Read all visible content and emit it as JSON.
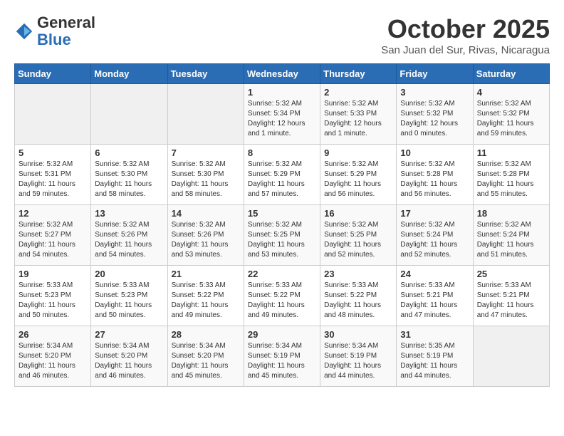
{
  "logo": {
    "general": "General",
    "blue": "Blue"
  },
  "title": "October 2025",
  "location": "San Juan del Sur, Rivas, Nicaragua",
  "days_of_week": [
    "Sunday",
    "Monday",
    "Tuesday",
    "Wednesday",
    "Thursday",
    "Friday",
    "Saturday"
  ],
  "weeks": [
    [
      {
        "day": "",
        "info": ""
      },
      {
        "day": "",
        "info": ""
      },
      {
        "day": "",
        "info": ""
      },
      {
        "day": "1",
        "info": "Sunrise: 5:32 AM\nSunset: 5:34 PM\nDaylight: 12 hours\nand 1 minute."
      },
      {
        "day": "2",
        "info": "Sunrise: 5:32 AM\nSunset: 5:33 PM\nDaylight: 12 hours\nand 1 minute."
      },
      {
        "day": "3",
        "info": "Sunrise: 5:32 AM\nSunset: 5:32 PM\nDaylight: 12 hours\nand 0 minutes."
      },
      {
        "day": "4",
        "info": "Sunrise: 5:32 AM\nSunset: 5:32 PM\nDaylight: 11 hours\nand 59 minutes."
      }
    ],
    [
      {
        "day": "5",
        "info": "Sunrise: 5:32 AM\nSunset: 5:31 PM\nDaylight: 11 hours\nand 59 minutes."
      },
      {
        "day": "6",
        "info": "Sunrise: 5:32 AM\nSunset: 5:30 PM\nDaylight: 11 hours\nand 58 minutes."
      },
      {
        "day": "7",
        "info": "Sunrise: 5:32 AM\nSunset: 5:30 PM\nDaylight: 11 hours\nand 58 minutes."
      },
      {
        "day": "8",
        "info": "Sunrise: 5:32 AM\nSunset: 5:29 PM\nDaylight: 11 hours\nand 57 minutes."
      },
      {
        "day": "9",
        "info": "Sunrise: 5:32 AM\nSunset: 5:29 PM\nDaylight: 11 hours\nand 56 minutes."
      },
      {
        "day": "10",
        "info": "Sunrise: 5:32 AM\nSunset: 5:28 PM\nDaylight: 11 hours\nand 56 minutes."
      },
      {
        "day": "11",
        "info": "Sunrise: 5:32 AM\nSunset: 5:28 PM\nDaylight: 11 hours\nand 55 minutes."
      }
    ],
    [
      {
        "day": "12",
        "info": "Sunrise: 5:32 AM\nSunset: 5:27 PM\nDaylight: 11 hours\nand 54 minutes."
      },
      {
        "day": "13",
        "info": "Sunrise: 5:32 AM\nSunset: 5:26 PM\nDaylight: 11 hours\nand 54 minutes."
      },
      {
        "day": "14",
        "info": "Sunrise: 5:32 AM\nSunset: 5:26 PM\nDaylight: 11 hours\nand 53 minutes."
      },
      {
        "day": "15",
        "info": "Sunrise: 5:32 AM\nSunset: 5:25 PM\nDaylight: 11 hours\nand 53 minutes."
      },
      {
        "day": "16",
        "info": "Sunrise: 5:32 AM\nSunset: 5:25 PM\nDaylight: 11 hours\nand 52 minutes."
      },
      {
        "day": "17",
        "info": "Sunrise: 5:32 AM\nSunset: 5:24 PM\nDaylight: 11 hours\nand 52 minutes."
      },
      {
        "day": "18",
        "info": "Sunrise: 5:32 AM\nSunset: 5:24 PM\nDaylight: 11 hours\nand 51 minutes."
      }
    ],
    [
      {
        "day": "19",
        "info": "Sunrise: 5:33 AM\nSunset: 5:23 PM\nDaylight: 11 hours\nand 50 minutes."
      },
      {
        "day": "20",
        "info": "Sunrise: 5:33 AM\nSunset: 5:23 PM\nDaylight: 11 hours\nand 50 minutes."
      },
      {
        "day": "21",
        "info": "Sunrise: 5:33 AM\nSunset: 5:22 PM\nDaylight: 11 hours\nand 49 minutes."
      },
      {
        "day": "22",
        "info": "Sunrise: 5:33 AM\nSunset: 5:22 PM\nDaylight: 11 hours\nand 49 minutes."
      },
      {
        "day": "23",
        "info": "Sunrise: 5:33 AM\nSunset: 5:22 PM\nDaylight: 11 hours\nand 48 minutes."
      },
      {
        "day": "24",
        "info": "Sunrise: 5:33 AM\nSunset: 5:21 PM\nDaylight: 11 hours\nand 47 minutes."
      },
      {
        "day": "25",
        "info": "Sunrise: 5:33 AM\nSunset: 5:21 PM\nDaylight: 11 hours\nand 47 minutes."
      }
    ],
    [
      {
        "day": "26",
        "info": "Sunrise: 5:34 AM\nSunset: 5:20 PM\nDaylight: 11 hours\nand 46 minutes."
      },
      {
        "day": "27",
        "info": "Sunrise: 5:34 AM\nSunset: 5:20 PM\nDaylight: 11 hours\nand 46 minutes."
      },
      {
        "day": "28",
        "info": "Sunrise: 5:34 AM\nSunset: 5:20 PM\nDaylight: 11 hours\nand 45 minutes."
      },
      {
        "day": "29",
        "info": "Sunrise: 5:34 AM\nSunset: 5:19 PM\nDaylight: 11 hours\nand 45 minutes."
      },
      {
        "day": "30",
        "info": "Sunrise: 5:34 AM\nSunset: 5:19 PM\nDaylight: 11 hours\nand 44 minutes."
      },
      {
        "day": "31",
        "info": "Sunrise: 5:35 AM\nSunset: 5:19 PM\nDaylight: 11 hours\nand 44 minutes."
      },
      {
        "day": "",
        "info": ""
      }
    ]
  ]
}
